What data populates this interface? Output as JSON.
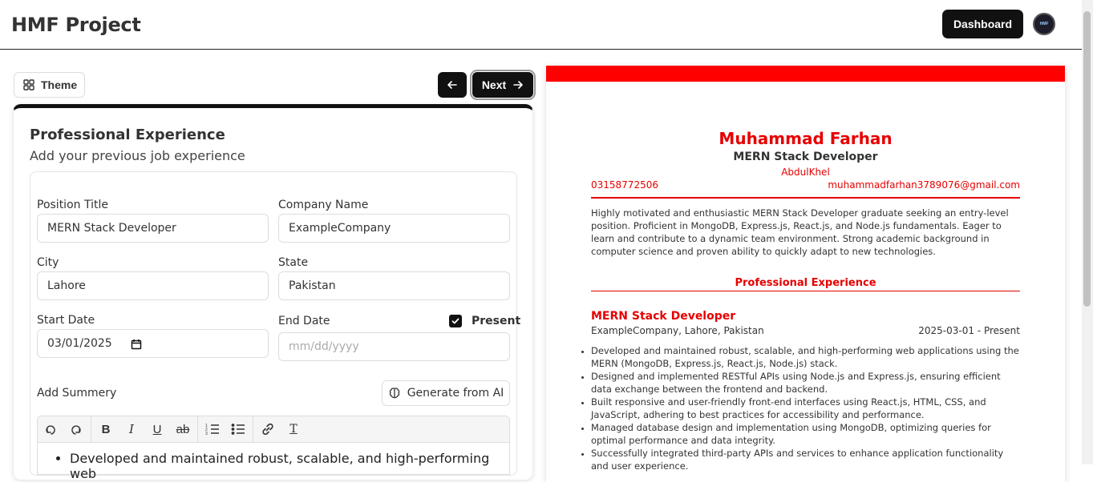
{
  "header": {
    "brand": "HMF Project",
    "dashboard_label": "Dashboard",
    "avatar_text": "HMF"
  },
  "controls": {
    "theme_label": "Theme",
    "next_label": "Next"
  },
  "form": {
    "title": "Professional Experience",
    "subtitle": "Add your previous job experience",
    "position_label": "Position Title",
    "position_value": "MERN Stack Developer",
    "company_label": "Company Name",
    "company_value": "ExampleCompany",
    "city_label": "City",
    "city_value": "Lahore",
    "state_label": "State",
    "state_value": "Pakistan",
    "start_label": "Start Date",
    "start_value": "03/01/2025",
    "end_label": "End Date",
    "end_placeholder": "mm/dd/yyyy",
    "present_label": "Present",
    "present_checked": true,
    "summary_label": "Add Summery",
    "generate_label": "Generate from AI",
    "editor_first_line": "Developed and maintained robust, scalable, and high-performing web"
  },
  "toolbar": {
    "undo": "undo-icon",
    "redo": "redo-icon",
    "bold": "B",
    "italic": "I",
    "underline": "U",
    "strike": "ab",
    "ordered_list": "ordered-list-icon",
    "bullet_list": "bullet-list-icon",
    "link": "link-icon",
    "clear": "T"
  },
  "resume": {
    "accent_color": "#ff0000",
    "name": "Muhammad Farhan",
    "job_title": "MERN Stack Developer",
    "address": "AbdulKhel",
    "phone": "03158772506",
    "email": "muhammadfarhan3789076@gmail.com",
    "summary": "Highly motivated and enthusiastic MERN Stack Developer graduate seeking an entry-level position. Proficient in MongoDB, Express.js, React.js, and Node.js fundamentals. Eager to learn and contribute to a dynamic team environment. Strong academic background in computer science and proven ability to quickly adapt to new technologies.",
    "section_title": "Professional Experience",
    "experience": {
      "title": "MERN Stack Developer",
      "company_line": "ExampleCompany, Lahore, Pakistan",
      "dates": "2025-03-01  -  Present",
      "bullets": [
        "Developed and maintained robust, scalable, and high-performing web applications using the MERN (MongoDB, Express.js, React.js, Node.js) stack.",
        "Designed and implemented RESTful APIs using Node.js and Express.js, ensuring efficient data exchange between the frontend and backend.",
        "Built responsive and user-friendly front-end interfaces using React.js, HTML, CSS, and JavaScript, adhering to best practices for accessibility and performance.",
        "Managed database design and implementation using MongoDB, optimizing queries for optimal performance and data integrity.",
        "Successfully integrated third-party APIs and services to enhance application functionality and user experience."
      ]
    }
  }
}
